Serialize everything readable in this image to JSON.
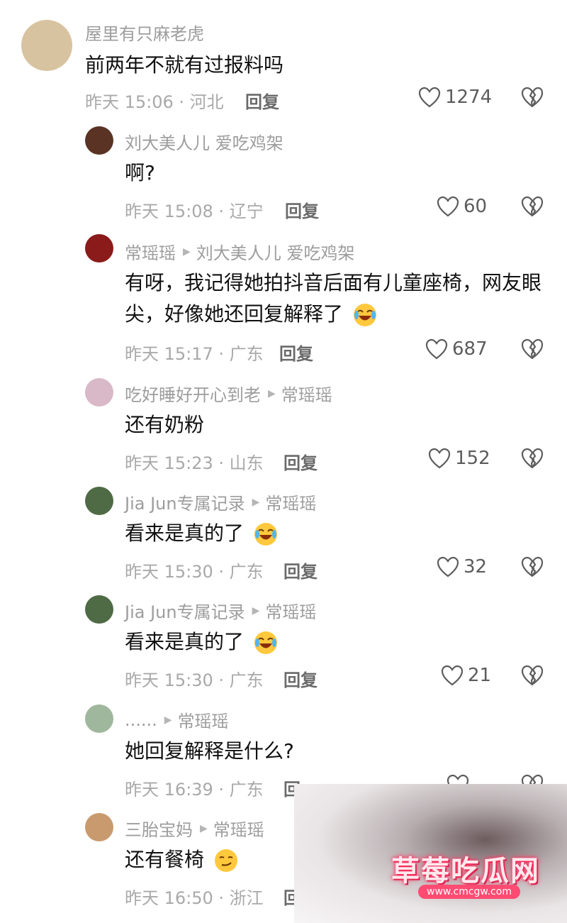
{
  "comments": [
    {
      "username": "屋里有只麻老虎",
      "reply_to": "",
      "text": "前两年不就有过报料吗",
      "time_loc": "昨天 15:06 · 河北",
      "reply_label": "回复",
      "likes": "1274",
      "avatar_color": "#d8c3a0"
    },
    {
      "username": "刘大美人儿 爱吃鸡架",
      "reply_to": "",
      "text": "啊?",
      "time_loc": "昨天 15:08 · 辽宁",
      "reply_label": "回复",
      "likes": "60",
      "avatar_color": "#5a3325"
    },
    {
      "username": "常瑶瑶",
      "reply_to": "刘大美人儿 爱吃鸡架",
      "text": "有呀，我记得她拍抖音后面有儿童座椅，网友眼尖，好像她还回复解释了",
      "time_loc": "昨天 15:17 · 广东",
      "reply_label": "回复",
      "likes": "687",
      "avatar_color": "#8b1a1a"
    },
    {
      "username": "吃好睡好开心到老",
      "reply_to": "常瑶瑶",
      "text": "还有奶粉",
      "time_loc": "昨天 15:23 · 山东",
      "reply_label": "回复",
      "likes": "152",
      "avatar_color": "#d9b8c7"
    },
    {
      "username": "Jia Jun专属记录",
      "reply_to": "常瑶瑶",
      "text": "看来是真的了",
      "time_loc": "昨天 15:30 · 广东",
      "reply_label": "回复",
      "likes": "32",
      "avatar_color": "#4f6b45"
    },
    {
      "username": "Jia Jun专属记录",
      "reply_to": "常瑶瑶",
      "text": "看来是真的了",
      "time_loc": "昨天 15:30 · 广东",
      "reply_label": "回复",
      "likes": "21",
      "avatar_color": "#4f6b45"
    },
    {
      "username": "......",
      "reply_to": "常瑶瑶",
      "text": "她回复解释是什么?",
      "time_loc": "昨天 16:39 · 广东",
      "reply_label": "回",
      "likes": "",
      "avatar_color": "#9fb79c"
    },
    {
      "username": "三胎宝妈",
      "reply_to": "常瑶瑶",
      "text": "还有餐椅",
      "time_loc": "昨天 16:50 · 浙江",
      "reply_label": "回",
      "likes": "",
      "avatar_color": "#c89a6e"
    }
  ],
  "watermark": {
    "title": "草莓吃瓜网",
    "url": "www.cmcgw.com"
  },
  "colors": {
    "username": "#9d9d9d",
    "text": "#111111",
    "meta": "#a9a9a9",
    "watermark_pink": "#ff4b72"
  }
}
